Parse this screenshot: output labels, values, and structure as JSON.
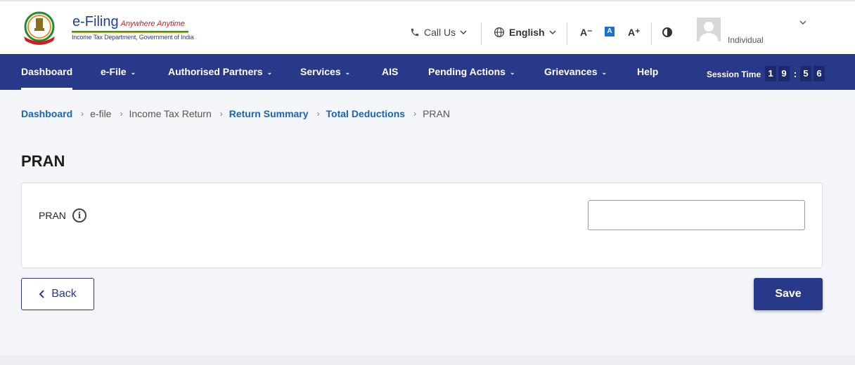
{
  "brand": {
    "name": "e-Filing",
    "tagline": "Anywhere Anytime",
    "subtitle": "Income Tax Department, Government of India"
  },
  "header": {
    "call_us": "Call Us",
    "language": "English",
    "font_decrease": "A⁻",
    "font_default": "A",
    "font_increase": "A⁺",
    "user_role": "Individual"
  },
  "nav": {
    "items": [
      {
        "label": "Dashboard",
        "has_menu": false
      },
      {
        "label": "e-File",
        "has_menu": true
      },
      {
        "label": "Authorised Partners",
        "has_menu": true
      },
      {
        "label": "Services",
        "has_menu": true
      },
      {
        "label": "AIS",
        "has_menu": false
      },
      {
        "label": "Pending Actions",
        "has_menu": true
      },
      {
        "label": "Grievances",
        "has_menu": true
      },
      {
        "label": "Help",
        "has_menu": false
      }
    ],
    "session_label": "Session Time",
    "session_digits": [
      "1",
      "9",
      "5",
      "6"
    ]
  },
  "breadcrumb": [
    {
      "label": "Dashboard",
      "link": true
    },
    {
      "label": "e-file",
      "link": false
    },
    {
      "label": "Income Tax Return",
      "link": false
    },
    {
      "label": "Return Summary",
      "link": true
    },
    {
      "label": "Total Deductions",
      "link": true
    },
    {
      "label": "PRAN",
      "link": false
    }
  ],
  "page": {
    "title": "PRAN",
    "field_label": "PRAN",
    "field_value": "",
    "info_glyph": "i"
  },
  "buttons": {
    "back": "Back",
    "save": "Save"
  },
  "colors": {
    "primary": "#29398a",
    "link": "#1b63b5",
    "background": "#f4f5f9"
  }
}
